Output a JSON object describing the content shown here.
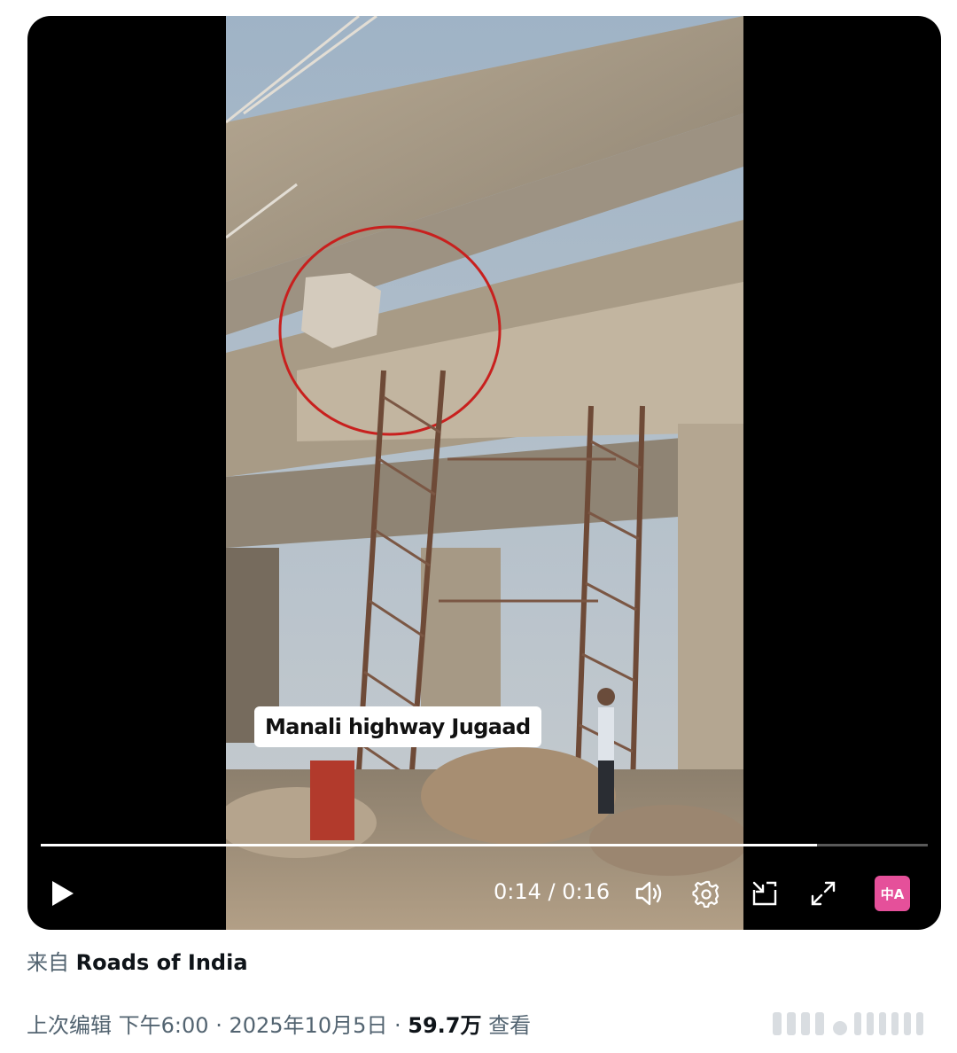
{
  "video": {
    "caption": "Manali highway Jugaad",
    "time_display": "0:14 / 0:16",
    "progress": 0.875,
    "controls": {
      "play": "play-icon",
      "volume": "volume-icon",
      "settings": "gear-icon",
      "pip": "picture-in-picture-icon",
      "fullscreen": "fullscreen-icon",
      "translate": "translate-icon",
      "translate_glyph": "中A"
    },
    "accent": "#e5509a"
  },
  "source": {
    "prefix": "来自",
    "name": "Roads of India"
  },
  "meta": {
    "edited_label": "上次编辑",
    "time": "下午6:00",
    "sep1": "·",
    "date": "2025年10月5日",
    "sep2": "·",
    "views": "59.7万",
    "views_label": "查看"
  }
}
